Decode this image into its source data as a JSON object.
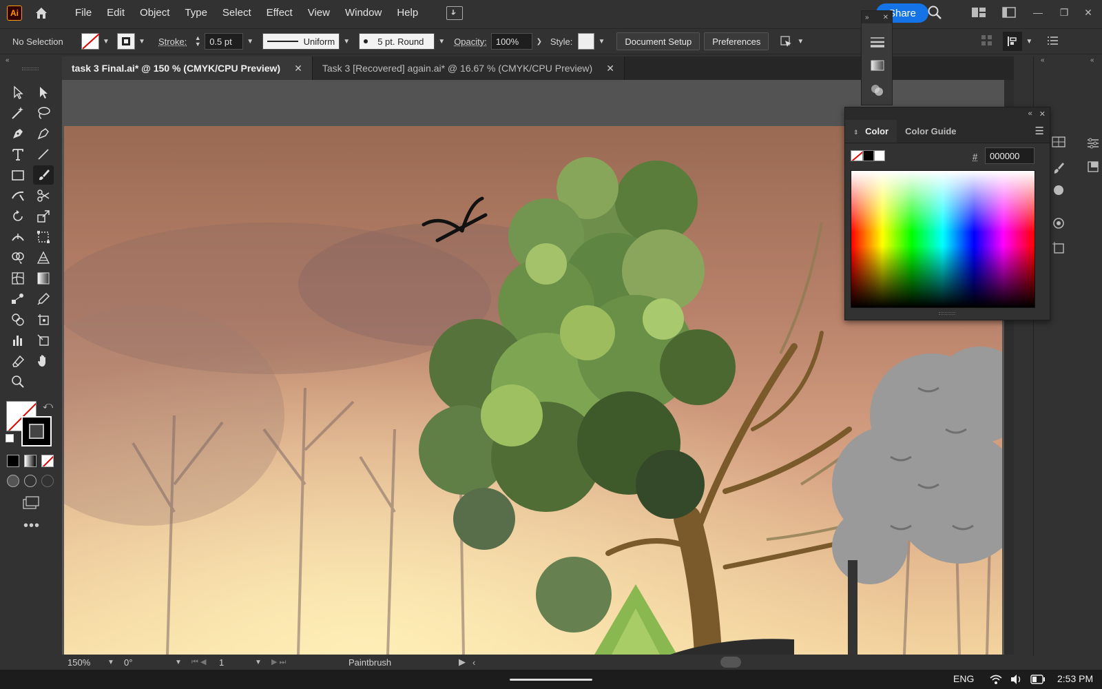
{
  "menubar": {
    "logo": "Ai",
    "items": [
      "File",
      "Edit",
      "Object",
      "Type",
      "Select",
      "Effect",
      "View",
      "Window",
      "Help"
    ],
    "share": "Share"
  },
  "controlbar": {
    "selection": "No Selection",
    "stroke_label": "Stroke:",
    "stroke_value": "0.5 pt",
    "profile": "Uniform",
    "brush": "5 pt. Round",
    "opacity_label": "Opacity:",
    "opacity_value": "100%",
    "style_label": "Style:",
    "document_setup": "Document Setup",
    "preferences": "Preferences"
  },
  "tabs": [
    {
      "title": "task 3 Final.ai* @ 150 % (CMYK/CPU Preview)",
      "active": true
    },
    {
      "title": "Task 3 [Recovered] again.ai* @ 16.67 % (CMYK/CPU Preview)",
      "active": false
    }
  ],
  "statusbar": {
    "zoom": "150%",
    "rotation": "0°",
    "artboard": "1",
    "tool": "Paintbrush"
  },
  "color_panel": {
    "tabs": [
      "Color",
      "Color Guide"
    ],
    "hex_label": "#",
    "hex_value": "000000"
  },
  "taskbar": {
    "lang": "ENG",
    "time": "2:53 PM"
  },
  "colors": {
    "accent": "#1473e6",
    "chrome": "#323232",
    "canvas": "#535353"
  }
}
